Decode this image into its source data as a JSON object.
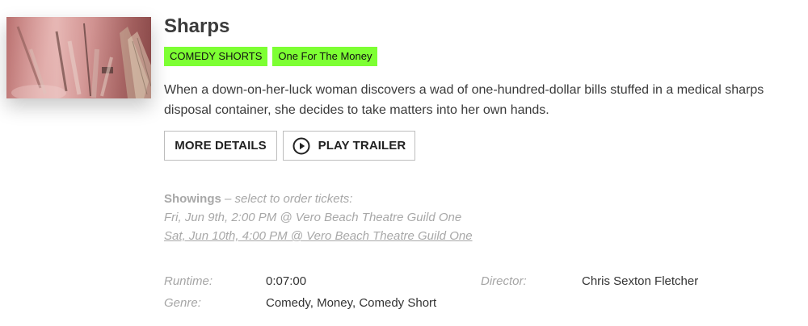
{
  "film": {
    "title": "Sharps",
    "tags": [
      "COMEDY SHORTS",
      "One For The Money"
    ],
    "tag_color": "#7dff33",
    "description": "When a down-on-her-luck woman discovers a wad of one-hundred-dollar bills stuffed in a medical sharps disposal container, she decides to take matters into her own hands."
  },
  "actions": {
    "more_details": "MORE DETAILS",
    "play_trailer": "PLAY TRAILER"
  },
  "showings": {
    "label": "Showings",
    "hint": "– select to order tickets:",
    "items": [
      "Fri, Jun 9th, 2:00 PM @ Vero Beach Theatre Guild One",
      "Sat, Jun 10th, 4:00 PM @ Vero Beach Theatre Guild One"
    ]
  },
  "details": {
    "runtime_label": "Runtime:",
    "runtime": "0:07:00",
    "director_label": "Director:",
    "director": "Chris Sexton Fletcher",
    "genre_label": "Genre:",
    "genre": "Comedy, Money, Comedy Short"
  },
  "icons": {
    "play": "play-circle-icon"
  }
}
